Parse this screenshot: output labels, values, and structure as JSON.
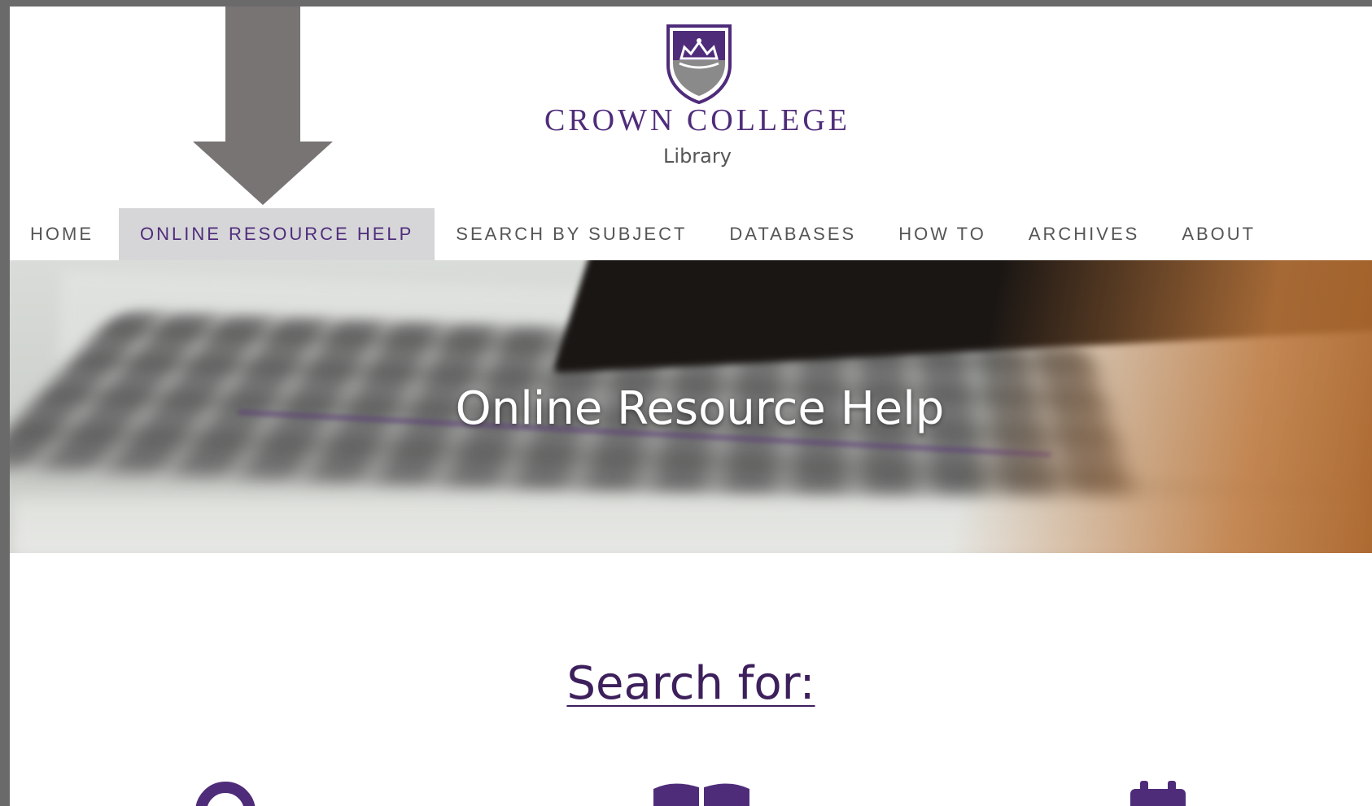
{
  "header": {
    "college_name": "CROWN COLLEGE",
    "subtitle": "Library"
  },
  "nav": {
    "items": [
      {
        "label": "HOME"
      },
      {
        "label": "ONLINE RESOURCE HELP",
        "active": true
      },
      {
        "label": "SEARCH BY SUBJECT"
      },
      {
        "label": "DATABASES"
      },
      {
        "label": "HOW TO"
      },
      {
        "label": "ARCHIVES"
      },
      {
        "label": "ABOUT"
      }
    ]
  },
  "hero": {
    "title": "Online Resource Help"
  },
  "main": {
    "search_heading": "Search for:",
    "icons": [
      "search-icon",
      "book-icon",
      "calendar-icon"
    ]
  },
  "colors": {
    "brand_purple": "#4f2c7a",
    "nav_active_bg": "#d6d6d9",
    "annotation_arrow": "#787474"
  }
}
